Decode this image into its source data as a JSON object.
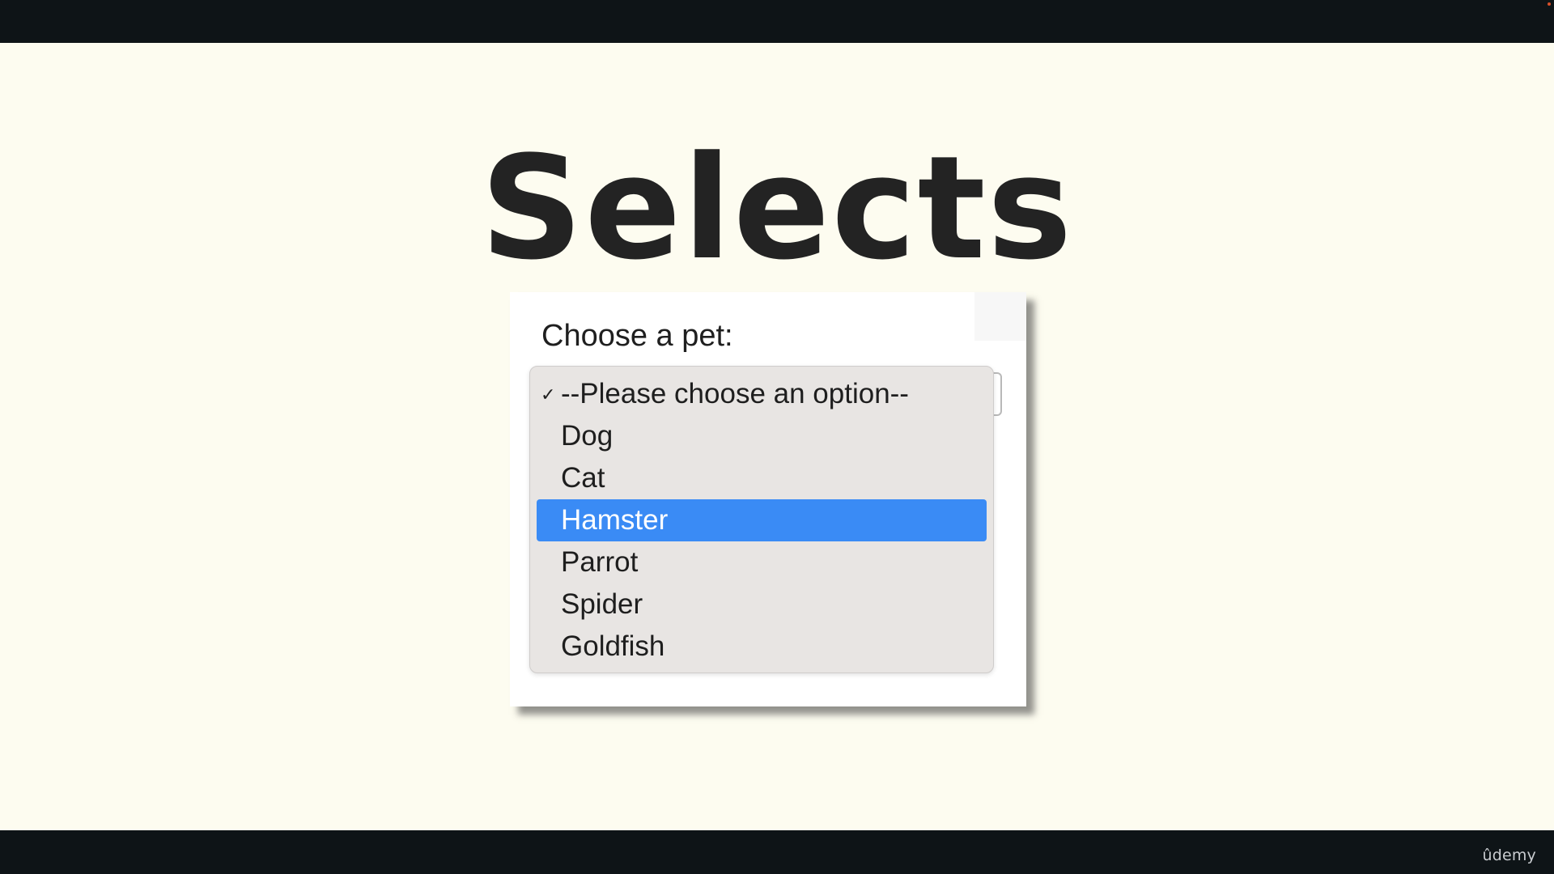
{
  "slide": {
    "title": "Selects"
  },
  "form": {
    "label": "Choose a pet:",
    "select": {
      "selected_value": "--Please choose an option--",
      "highlighted_value": "Hamster",
      "options": [
        {
          "label": "--Please choose an option--",
          "checked": true
        },
        {
          "label": "Dog"
        },
        {
          "label": "Cat"
        },
        {
          "label": "Hamster",
          "highlighted": true
        },
        {
          "label": "Parrot"
        },
        {
          "label": "Spider"
        },
        {
          "label": "Goldfish"
        }
      ]
    }
  },
  "icons": {
    "check": "✓"
  },
  "footer": {
    "brand": "ûdemy"
  },
  "colors": {
    "slide_background": "#fdfcf0",
    "frame_bars": "#0e1417",
    "highlight": "#3a8bf5",
    "menu_background": "#e8e5e3"
  }
}
